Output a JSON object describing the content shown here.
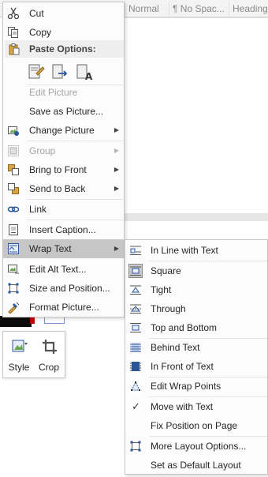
{
  "ribbon": {
    "styles": [
      "Normal",
      "¶ No Spac...",
      "Heading"
    ]
  },
  "menu": {
    "cut": "Cut",
    "copy": "Copy",
    "paste_options": "Paste Options:",
    "edit_picture": "Edit Picture",
    "save_as_picture": "Save as Picture...",
    "change_picture": "Change Picture",
    "group": "Group",
    "bring_to_front": "Bring to Front",
    "send_to_back": "Send to Back",
    "link": "Link",
    "insert_caption": "Insert Caption...",
    "wrap_text": "Wrap Text",
    "edit_alt_text": "Edit Alt Text...",
    "size_and_position": "Size and Position...",
    "format_picture": "Format Picture..."
  },
  "mini_toolbar": {
    "style": "Style",
    "crop": "Crop"
  },
  "submenu": {
    "in_line": "In Line with Text",
    "square": "Square",
    "tight": "Tight",
    "through": "Through",
    "top_bottom": "Top and Bottom",
    "behind": "Behind Text",
    "in_front": "In Front of Text",
    "edit_wrap_points": "Edit Wrap Points",
    "move_with_text": "Move with Text",
    "fix_position": "Fix Position on Page",
    "more_layout": "More Layout Options...",
    "set_default": "Set as Default Layout",
    "selected": "square",
    "checked": "move_with_text"
  },
  "icons": {
    "cut": "scissors-icon",
    "copy": "copy-icon",
    "paste": "paste-icon",
    "check": "✓"
  },
  "colors": {
    "accent_blue": "#2b579a",
    "highlight": "#c6c6c6",
    "disabled": "#a3a3a3"
  }
}
